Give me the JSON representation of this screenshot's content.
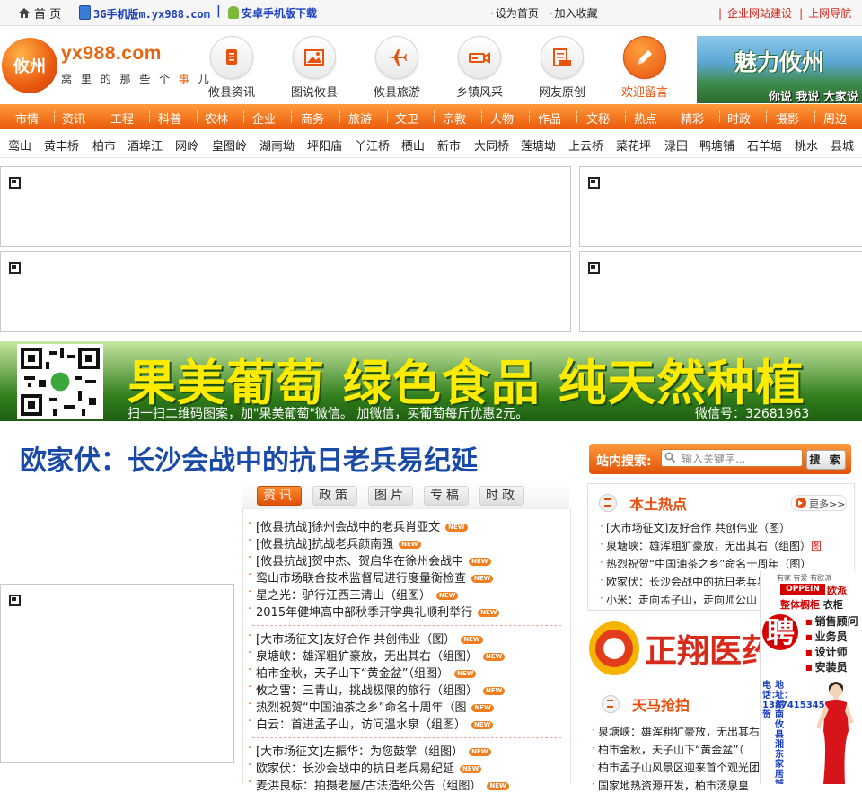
{
  "topbar": {
    "home": "首 页",
    "mobile_3g": "3G手机版m.yx988.com",
    "divider": "|",
    "android": "安卓手机版下载",
    "links": [
      "设为首页",
      "加入收藏"
    ],
    "right_links": [
      "企业网站建设",
      "上网导航"
    ],
    "right_sep": "|"
  },
  "logo": {
    "badge": "攸州",
    "url": "yx988.com",
    "slogan_a": "窝 里 的 那 些 个 ",
    "slogan_b": "事",
    "slogan_c": " 儿"
  },
  "nav_icons": [
    {
      "label": "攸县资讯",
      "icon": "news-icon"
    },
    {
      "label": "图说攸县",
      "icon": "picture-icon"
    },
    {
      "label": "攸县旅游",
      "icon": "airplane-icon"
    },
    {
      "label": "乡镇风采",
      "icon": "video-camera-icon"
    },
    {
      "label": "网友原创",
      "icon": "document-icon"
    },
    {
      "label": "欢迎留言",
      "icon": "pencil-icon"
    }
  ],
  "banner_top": {
    "title": "魅力攸州",
    "sub": "你说 我说 大家说"
  },
  "channels": [
    "市情",
    "资讯",
    "工程",
    "科普",
    "农林",
    "企业",
    "商务",
    "旅游",
    "文卫",
    "宗教",
    "人物",
    "作品",
    "文秘",
    "热点",
    "精彩",
    "时政",
    "摄影",
    "周边"
  ],
  "places": [
    "鸾山",
    "黄丰桥",
    "柏市",
    "酒埠江",
    "网岭",
    "皇图岭",
    "湖南坳",
    "坪阳庙",
    "丫江桥",
    "槚山",
    "新市",
    "大同桥",
    "莲塘坳",
    "上云桥",
    "菜花坪",
    "渌田",
    "鸭塘铺",
    "石羊塘",
    "桃水",
    "县城"
  ],
  "big_ad": {
    "slogan": "果美葡萄  绿色食品  纯天然种植",
    "sub": "扫一扫二维码图案，加\"果美葡萄\"微信。   加微信，买葡萄每斤优惠2元。",
    "wechat": "微信号：32681963"
  },
  "headline": "欧家伏：长沙会战中的抗日老兵易纪延",
  "tabs": [
    "资讯",
    "政策",
    "图片",
    "专稿",
    "时政"
  ],
  "new_tag": "NEW",
  "news": {
    "group1": [
      "[攸县抗战]徐州会战中的老兵肖亚文",
      "[攸县抗战]抗战老兵颜南强",
      "[攸县抗战]贺中杰、贺启华在徐州会战中",
      "鸾山市场联合技术监督局进行度量衡检查",
      "星之光：驴行江西三清山（组图）",
      "2015年健坤高中部秋季开学典礼顺利举行"
    ],
    "group2": [
      "[大市场征文]友好合作 共创伟业（图）",
      "泉塘峡：雄浑粗犷豪放，无出其右（组图）",
      "柏市金秋，天子山下“黄金盆”（组图）",
      "攸之雪：三青山，挑战极限的旅行（组图）",
      "热烈祝贺“中国油茶之乡”命名十周年（图",
      "白云：首进孟子山，访问温水泉（组图）"
    ],
    "group3": [
      "[大市场征文]左振华：为您鼓掌（组图）",
      "欧家伏：长沙会战中的抗日老兵易纪延",
      "麦洪良标：拍摄老屋/古法造纸公告（组图）"
    ]
  },
  "search": {
    "label": "站内搜索:",
    "placeholder": "输入关键字...",
    "button": "搜 索"
  },
  "hot": {
    "title": "本土热点",
    "more": "更多>>",
    "items": [
      {
        "text": "[大市场征文]友好合作 共创伟业（图）",
        "pic": ""
      },
      {
        "text": "泉塘峡：雄浑粗犷豪放，无出其右（组图）",
        "pic": "图"
      },
      {
        "text": "热烈祝贺“中国油茶之乡”命名十周年（图）",
        "pic": ""
      },
      {
        "text": "欧家伏：长沙会战中的抗日老兵易纪延",
        "pic": ""
      },
      {
        "text": "小米：走向孟子山，走向师公山",
        "pic": ""
      }
    ]
  },
  "zx_ad": {
    "text": "正翔医药 供"
  },
  "tianma": {
    "title": "天马抢拍",
    "items": [
      "泉塘峡：雄浑粗犷豪放，无出其右",
      "柏市金秋，天子山下“黄金盆”（",
      "柏市孟子山风景区迎来首个观光团",
      "国家地热资源开发，柏市汤泉皇"
    ]
  },
  "recruit": {
    "top": "有家 有爱 有欧派",
    "brand": "OPPEIN",
    "brand2": "欧派",
    "brand3": "整体橱柜",
    "brand3b": " 衣柜",
    "pin": "聘",
    "jobs": [
      "销售顾问",
      "业务员",
      "设计师",
      "安装员"
    ],
    "vtext": "地址：湖南攸县湘东家居城二楼",
    "vtext2": "电话：13874153451 贺"
  },
  "colors": {
    "accent": "#ea5a0c",
    "headline": "#1a4aa8",
    "link_blue": "#1a3fbf",
    "red": "#d9261c"
  }
}
